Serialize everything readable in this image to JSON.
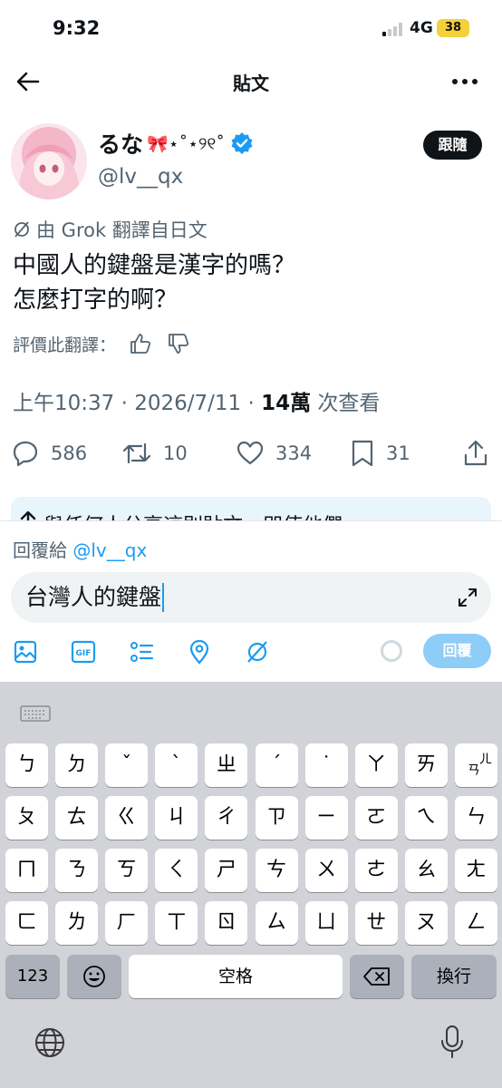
{
  "status_bar": {
    "time": "9:32",
    "network": "4G",
    "battery": "38"
  },
  "header": {
    "title": "貼文",
    "back_icon": "back-arrow-icon",
    "more_icon": "more-icon"
  },
  "author": {
    "name": "るな",
    "name_decoration": "🎀⋆˚⋆୨୧˚",
    "handle": "@lv__qx",
    "follow_label": "跟隨"
  },
  "post": {
    "translation_note": "由 Grok 翻譯自日文",
    "body_line1": "中國人的鍵盤是漢字的嗎？",
    "body_line2": "怎麼打字的啊？",
    "rate_label": "評價此翻譯：",
    "time": "上午10:37 · 2026/7/11 · ",
    "views_count": "14萬",
    "views_label": " 次查看"
  },
  "actions": {
    "replies": "586",
    "reposts": "10",
    "likes": "334",
    "bookmarks": "31"
  },
  "banner_peek": "與任何人分享這則貼文，即使他們",
  "composer": {
    "reply_prefix": "回覆給 ",
    "reply_mention": "@lv__qx",
    "input_value": "台灣人的鍵盤",
    "reply_button": "回覆"
  },
  "keyboard": {
    "row1": [
      "ㄅ",
      "ㄉ",
      "ˇ",
      "ˋ",
      "ㄓ",
      "ˊ",
      "˙",
      "ㄚ",
      "ㄞ",
      ""
    ],
    "row1_last_sub": "ㄢ",
    "row1_last_sup": "ㄦ",
    "row2": [
      "ㄆ",
      "ㄊ",
      "ㄍ",
      "ㄐ",
      "ㄔ",
      "ㄗ",
      "ㄧ",
      "ㄛ",
      "ㄟ",
      "ㄣ"
    ],
    "row3": [
      "ㄇ",
      "ㄋ",
      "ㄎ",
      "ㄑ",
      "ㄕ",
      "ㄘ",
      "ㄨ",
      "ㄜ",
      "ㄠ",
      "ㄤ"
    ],
    "row4": [
      "ㄈ",
      "ㄌ",
      "ㄏ",
      "ㄒ",
      "ㄖ",
      "ㄙ",
      "ㄩ",
      "ㄝ",
      "ㄡ",
      "ㄥ"
    ],
    "numbers_key": "123",
    "space_key": "空格",
    "return_key": "換行"
  },
  "colors": {
    "accent": "#1d9bf0",
    "reply_button": "#8ecdf8",
    "verified": "#1d9bf0"
  }
}
